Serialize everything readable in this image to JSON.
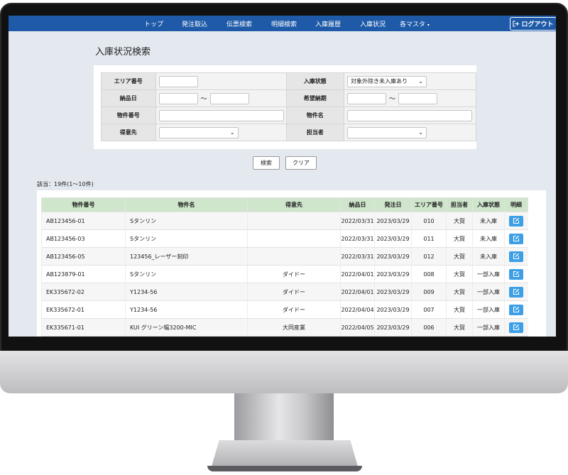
{
  "nav": {
    "items": [
      "トップ",
      "発注取込",
      "伝票検索",
      "明細検索",
      "入庫履歴",
      "入庫状況",
      "各マスタ"
    ],
    "logout_label": "ログアウト"
  },
  "page_title": "入庫状況検索",
  "form": {
    "area_label": "エリア番号",
    "area_value": "",
    "status_label": "入庫状態",
    "status_value": "対象外除き未入庫あり",
    "delivery_label": "納品日",
    "tilde": "〜",
    "desired_label": "希望納期",
    "item_no_label": "物件番号",
    "item_name_label": "物件名",
    "customer_label": "得意先",
    "staff_label": "担当者"
  },
  "buttons": {
    "search": "検索",
    "clear": "クリア"
  },
  "result_count": "該当：19件(1〜10件)",
  "table": {
    "headers": [
      "物件番号",
      "物件名",
      "得意先",
      "納品日",
      "発注日",
      "エリア番号",
      "担当者",
      "入庫状態",
      "明細"
    ],
    "rows": [
      [
        "AB123456-01",
        "Sタンリン",
        "",
        "2022/03/31",
        "2023/03/29",
        "010",
        "大賀",
        "未入庫"
      ],
      [
        "AB123456-03",
        "Sタンリン",
        "",
        "2022/03/31",
        "2023/03/29",
        "011",
        "大賀",
        "未入庫"
      ],
      [
        "AB123456-05",
        "123456_レーザー刻印",
        "",
        "2022/03/31",
        "2023/03/29",
        "012",
        "大賀",
        "未入庫"
      ],
      [
        "AB123879-01",
        "Sタンリン",
        "ダイドー",
        "2022/04/01",
        "2023/03/29",
        "008",
        "大賀",
        "一部入庫"
      ],
      [
        "EK335672-02",
        "Y1234-56",
        "ダイドー",
        "2022/04/01",
        "2023/03/29",
        "009",
        "大賀",
        "一部入庫"
      ],
      [
        "EK335672-01",
        "Y1234-56",
        "ダイドー",
        "2022/04/04",
        "2023/03/29",
        "007",
        "大賀",
        "一部入庫"
      ],
      [
        "EK335671-01",
        "KUI グリーン幅3200-MIC",
        "大同産業",
        "2022/04/05",
        "2023/03/29",
        "006",
        "大賀",
        "一部入庫"
      ]
    ]
  },
  "icons": {
    "logout": "logout-icon",
    "edit": "edit-icon",
    "caret": "caret-down-icon",
    "chevron": "chevron-down-icon"
  },
  "colors": {
    "navbar": "#1e5aa8",
    "header_row": "#cfe6cc",
    "edit_button": "#3d9fe6",
    "screen_bg": "#e4e9f0"
  }
}
